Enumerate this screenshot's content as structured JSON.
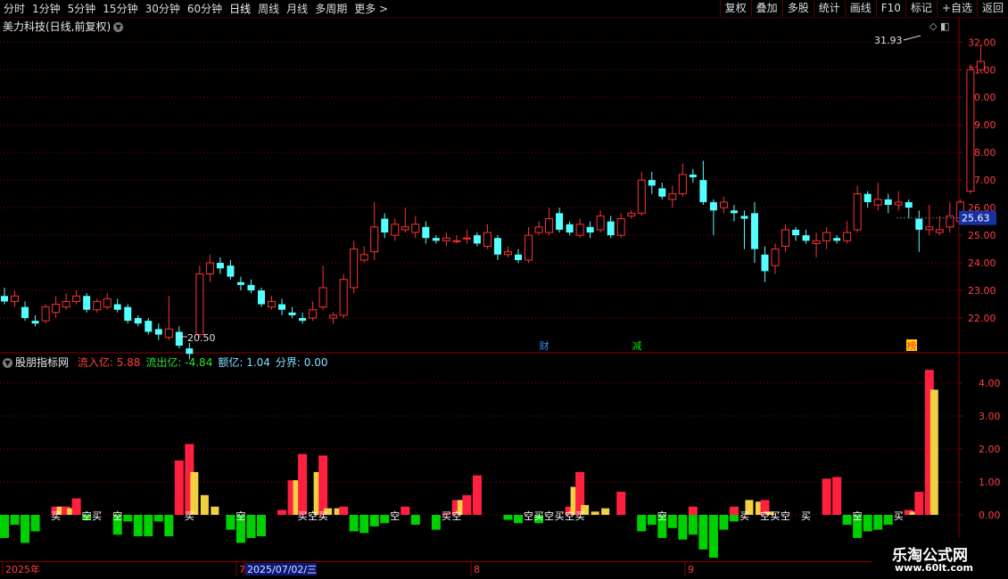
{
  "toolbar": {
    "periods": [
      "分时",
      "1分钟",
      "5分钟",
      "15分钟",
      "30分钟",
      "60分钟",
      "日线",
      "周线",
      "月线",
      "多周期",
      "更多 >"
    ],
    "active_period": "日线",
    "buttons": [
      "复权",
      "叠加",
      "多股",
      "统计",
      "画线",
      "F10",
      "标记",
      "+自选",
      "返回"
    ]
  },
  "main_chart": {
    "title": "美力科技(日线,前复权)",
    "price_ticks": [
      "32.00",
      "31.00",
      "30.00",
      "29.00",
      "28.00",
      "27.00",
      "26.00",
      "25.00",
      "24.00",
      "23.00",
      "22.00"
    ],
    "current_price": "25.63",
    "high_label": "31.93",
    "low_label": "20.50",
    "event_markers": [
      {
        "label": "财",
        "color": "#3a8cff"
      },
      {
        "label": "减",
        "color": "#00e000"
      },
      {
        "label": "榜",
        "color": "#ff3030",
        "bg": "#ffd000"
      }
    ]
  },
  "indicator": {
    "name": "股朋指标网",
    "fields": [
      {
        "label": "流入亿:",
        "value": "5.88",
        "color": "#ff4040"
      },
      {
        "label": "流出亿:",
        "value": "-4.84",
        "color": "#30e030"
      },
      {
        "label": "额亿:",
        "value": "1.04",
        "color": "#80e0ff"
      },
      {
        "label": "分界:",
        "value": "0.00",
        "color": "#80e0ff"
      }
    ],
    "ticks": [
      "4.00",
      "3.00",
      "2.00",
      "1.00",
      "0.00"
    ],
    "signals": {
      "buy": "买",
      "sell": "空"
    }
  },
  "date_axis": {
    "items": [
      {
        "label": "2025年",
        "highlight": false
      },
      {
        "label": "7",
        "highlight": false
      },
      {
        "label": "2025/07/02/三",
        "highlight": true
      },
      {
        "label": "8",
        "highlight": false
      },
      {
        "label": "9",
        "highlight": false
      }
    ]
  },
  "watermark": {
    "line1": "乐淘公式网",
    "line2": "www.60lt.com"
  },
  "colors": {
    "up": "#ff3232",
    "down": "#54ffff",
    "grid": "#8a0000",
    "inflow": "#ff2040",
    "outflow": "#00d000",
    "net": "#f0d040"
  },
  "chart_data": {
    "type": "candlestick",
    "y_range": [
      21.0,
      32.3
    ],
    "candles": [
      [
        22.8,
        22.6,
        23.1,
        22.5
      ],
      [
        22.6,
        22.8,
        23.0,
        22.4
      ],
      [
        22.4,
        22.0,
        22.6,
        21.9
      ],
      [
        21.9,
        21.8,
        22.1,
        21.7
      ],
      [
        21.9,
        22.4,
        22.5,
        21.8
      ],
      [
        22.2,
        22.5,
        22.8,
        22.0
      ],
      [
        22.4,
        22.6,
        22.9,
        22.3
      ],
      [
        22.6,
        22.8,
        23.0,
        22.5
      ],
      [
        22.8,
        22.3,
        22.9,
        22.2
      ],
      [
        22.3,
        22.6,
        22.7,
        22.2
      ],
      [
        22.4,
        22.7,
        22.9,
        22.3
      ],
      [
        22.5,
        22.3,
        22.7,
        22.2
      ],
      [
        22.4,
        21.9,
        22.5,
        21.8
      ],
      [
        22.0,
        21.8,
        22.1,
        21.7
      ],
      [
        21.9,
        21.5,
        22.0,
        21.4
      ],
      [
        21.6,
        21.4,
        21.8,
        21.2
      ],
      [
        21.3,
        21.6,
        22.8,
        21.2
      ],
      [
        21.5,
        21.0,
        21.7,
        20.9
      ],
      [
        20.9,
        20.7,
        21.1,
        20.5
      ],
      [
        21.4,
        23.6,
        23.9,
        21.3
      ],
      [
        23.6,
        24.0,
        24.3,
        23.3
      ],
      [
        24.0,
        23.8,
        24.2,
        23.6
      ],
      [
        23.9,
        23.5,
        24.1,
        23.4
      ],
      [
        23.3,
        23.2,
        23.5,
        23.0
      ],
      [
        23.2,
        23.0,
        23.4,
        22.9
      ],
      [
        23.0,
        22.5,
        23.1,
        22.4
      ],
      [
        22.4,
        22.6,
        22.8,
        22.3
      ],
      [
        22.5,
        22.3,
        22.7,
        22.1
      ],
      [
        22.2,
        22.1,
        22.4,
        22.0
      ],
      [
        22.0,
        21.9,
        22.2,
        21.8
      ],
      [
        22.0,
        22.3,
        22.6,
        21.9
      ],
      [
        22.4,
        23.1,
        23.9,
        22.3
      ],
      [
        22.0,
        22.1,
        22.2,
        21.8
      ],
      [
        22.1,
        23.4,
        23.6,
        22.0
      ],
      [
        23.1,
        24.5,
        24.8,
        22.9
      ],
      [
        24.1,
        24.3,
        24.6,
        24.0
      ],
      [
        24.4,
        25.3,
        26.2,
        24.1
      ],
      [
        25.6,
        25.1,
        25.8,
        24.9
      ],
      [
        25.0,
        25.4,
        25.6,
        24.8
      ],
      [
        25.2,
        25.3,
        26.0,
        25.1
      ],
      [
        25.1,
        25.4,
        25.7,
        24.9
      ],
      [
        25.3,
        24.9,
        25.5,
        24.7
      ],
      [
        24.9,
        24.8,
        25.0,
        24.7
      ],
      [
        24.8,
        24.9,
        25.1,
        24.6
      ],
      [
        24.8,
        24.8,
        25.0,
        24.7
      ],
      [
        24.9,
        24.9,
        25.2,
        24.7
      ],
      [
        25.0,
        24.7,
        25.1,
        24.6
      ],
      [
        24.6,
        25.1,
        25.4,
        24.5
      ],
      [
        24.9,
        24.3,
        25.0,
        24.1
      ],
      [
        24.3,
        24.4,
        24.6,
        24.2
      ],
      [
        24.3,
        24.1,
        24.5,
        24.0
      ],
      [
        24.1,
        25.0,
        25.3,
        24.0
      ],
      [
        25.1,
        25.3,
        25.5,
        25.0
      ],
      [
        25.1,
        25.6,
        26.0,
        25.0
      ],
      [
        25.8,
        25.2,
        26.0,
        25.1
      ],
      [
        25.4,
        25.1,
        25.5,
        25.0
      ],
      [
        25.0,
        25.4,
        25.6,
        24.9
      ],
      [
        25.3,
        25.1,
        25.5,
        24.9
      ],
      [
        25.2,
        25.7,
        25.9,
        25.1
      ],
      [
        25.5,
        25.0,
        25.7,
        24.9
      ],
      [
        25.0,
        25.6,
        25.8,
        24.9
      ],
      [
        25.7,
        25.8,
        25.9,
        25.6
      ],
      [
        25.8,
        27.0,
        27.3,
        25.7
      ],
      [
        27.0,
        26.8,
        27.3,
        26.5
      ],
      [
        26.7,
        26.4,
        26.9,
        26.3
      ],
      [
        26.3,
        26.5,
        26.8,
        26.0
      ],
      [
        26.5,
        27.2,
        27.6,
        26.4
      ],
      [
        27.2,
        27.1,
        27.4,
        26.9
      ],
      [
        27.0,
        26.2,
        27.7,
        26.1
      ],
      [
        26.2,
        25.9,
        26.3,
        25.0
      ],
      [
        26.0,
        26.2,
        26.4,
        25.8
      ],
      [
        25.9,
        25.8,
        26.1,
        25.5
      ],
      [
        25.7,
        25.6,
        25.9,
        24.5
      ],
      [
        25.8,
        24.5,
        26.2,
        24.0
      ],
      [
        24.3,
        23.7,
        24.6,
        23.3
      ],
      [
        23.9,
        24.5,
        24.7,
        23.6
      ],
      [
        24.6,
        25.2,
        25.4,
        24.4
      ],
      [
        25.2,
        25.0,
        25.3,
        24.8
      ],
      [
        25.0,
        24.8,
        25.2,
        24.7
      ],
      [
        24.7,
        24.8,
        25.1,
        24.2
      ],
      [
        24.8,
        25.1,
        25.3,
        24.5
      ],
      [
        24.9,
        24.8,
        25.0,
        24.7
      ],
      [
        24.8,
        25.1,
        25.5,
        24.7
      ],
      [
        25.2,
        26.5,
        26.8,
        25.1
      ],
      [
        26.5,
        26.2,
        26.6,
        26.0
      ],
      [
        26.1,
        26.3,
        26.9,
        25.9
      ],
      [
        26.3,
        26.1,
        26.5,
        25.8
      ],
      [
        26.1,
        26.2,
        26.6,
        25.9
      ],
      [
        26.2,
        26.0,
        26.3,
        25.6
      ],
      [
        25.6,
        25.2,
        25.9,
        24.4
      ],
      [
        25.2,
        25.3,
        26.1,
        25.0
      ],
      [
        25.1,
        25.2,
        25.7,
        25.0
      ],
      [
        25.3,
        25.7,
        26.2,
        25.1
      ],
      [
        25.5,
        26.2,
        26.3,
        25.4
      ],
      [
        26.6,
        31.0,
        31.2,
        26.5
      ],
      [
        31.0,
        31.3,
        31.9,
        30.9
      ]
    ],
    "inflow": [
      0.0,
      0.0,
      0.0,
      0.0,
      0.0,
      0.25,
      0.25,
      0.5,
      0.0,
      0.0,
      0.0,
      0.0,
      0.0,
      0.0,
      0.0,
      0.0,
      0.0,
      1.65,
      2.15,
      0.0,
      0.0,
      0.0,
      0.0,
      0.0,
      0.0,
      0.0,
      0.0,
      0.15,
      1.05,
      1.85,
      0.0,
      1.8,
      0.0,
      0.25,
      0.0,
      0.0,
      0.0,
      0.0,
      0.0,
      0.25,
      0.0,
      0.0,
      0.0,
      0.05,
      0.45,
      0.6,
      1.2,
      0.0,
      0.0,
      0.0,
      0.0,
      0.0,
      0.0,
      0.0,
      0.0,
      0.25,
      1.3,
      0.0,
      0.0,
      0.0,
      0.7,
      0.0,
      0.0,
      0.0,
      0.0,
      0.0,
      0.0,
      0.25,
      0.0,
      0.0,
      0.0,
      0.25,
      0.0,
      0.0,
      0.45,
      0.0,
      0.0,
      0.0,
      0.0,
      0.0,
      1.1,
      1.15,
      0.0,
      0.0,
      0.0,
      0.0,
      0.0,
      0.0,
      0.15,
      0.7,
      4.4
    ],
    "outflow": [
      -0.7,
      -0.3,
      -0.85,
      -0.5,
      0.0,
      0.0,
      0.0,
      0.0,
      -0.15,
      0.0,
      0.0,
      -0.6,
      -0.2,
      -0.65,
      -0.65,
      -0.2,
      -0.65,
      0.0,
      0.0,
      0.0,
      0.0,
      0.0,
      -0.45,
      -0.85,
      -0.7,
      -0.65,
      0.0,
      0.0,
      0.0,
      0.0,
      0.0,
      0.0,
      0.0,
      0.0,
      -0.5,
      -0.55,
      -0.35,
      -0.25,
      0.0,
      0.0,
      -0.3,
      0.0,
      -0.45,
      0.0,
      0.0,
      0.0,
      0.0,
      0.0,
      0.0,
      -0.15,
      -0.25,
      0.0,
      -0.25,
      0.0,
      0.0,
      0.0,
      0.0,
      0.0,
      0.0,
      0.0,
      0.0,
      0.0,
      -0.5,
      -0.3,
      -0.7,
      -0.4,
      -0.75,
      -0.6,
      -1.05,
      -1.3,
      -0.45,
      -0.2,
      0.0,
      0.0,
      0.0,
      0.0,
      0.0,
      0.0,
      0.0,
      0.0,
      0.0,
      0.0,
      -0.3,
      -0.7,
      -0.5,
      -0.45,
      -0.3,
      0.0,
      0.0,
      0.0,
      0.0
    ],
    "net": [
      0.0,
      0.0,
      0.0,
      0.0,
      0.0,
      0.25,
      0.2,
      0.0,
      0.0,
      0.0,
      0.0,
      0.0,
      0.0,
      0.0,
      0.0,
      0.0,
      0.0,
      0.0,
      1.3,
      0.6,
      0.25,
      0.0,
      0.0,
      0.0,
      0.0,
      0.0,
      0.0,
      0.0,
      1.05,
      0.0,
      1.3,
      0.2,
      0.2,
      0.0,
      0.0,
      0.0,
      0.0,
      0.0,
      0.0,
      0.0,
      0.0,
      0.0,
      0.0,
      0.0,
      0.45,
      0.0,
      0.0,
      0.0,
      0.0,
      0.0,
      0.0,
      0.0,
      0.0,
      0.0,
      0.0,
      0.85,
      0.3,
      0.1,
      0.2,
      0.0,
      0.0,
      0.0,
      0.0,
      0.0,
      0.0,
      0.0,
      0.0,
      0.0,
      0.0,
      0.0,
      0.0,
      0.0,
      0.45,
      0.4,
      0.1,
      0.0,
      0.0,
      0.0,
      0.0,
      0.0,
      0.0,
      0.0,
      0.0,
      0.0,
      0.0,
      0.0,
      0.0,
      0.0,
      0.1,
      0.0,
      3.8
    ],
    "signal_positions": [
      {
        "index": 5,
        "type": "buy"
      },
      {
        "index": 8,
        "type": "sell"
      },
      {
        "index": 9,
        "type": "buy"
      },
      {
        "index": 11,
        "type": "sell"
      },
      {
        "index": 18,
        "type": "buy"
      },
      {
        "index": 23,
        "type": "sell"
      },
      {
        "index": 29,
        "type": "buy"
      },
      {
        "index": 30,
        "type": "sell"
      },
      {
        "index": 31,
        "type": "buy"
      },
      {
        "index": 38,
        "type": "sell"
      },
      {
        "index": 43,
        "type": "buy"
      },
      {
        "index": 44,
        "type": "sell"
      },
      {
        "index": 51,
        "type": "sell"
      },
      {
        "index": 52,
        "type": "buy"
      },
      {
        "index": 53,
        "type": "sell"
      },
      {
        "index": 54,
        "type": "buy"
      },
      {
        "index": 55,
        "type": "sell"
      },
      {
        "index": 56,
        "type": "buy"
      },
      {
        "index": 64,
        "type": "sell"
      },
      {
        "index": 72,
        "type": "buy"
      },
      {
        "index": 74,
        "type": "sell"
      },
      {
        "index": 75,
        "type": "buy"
      },
      {
        "index": 76,
        "type": "sell"
      },
      {
        "index": 78,
        "type": "buy"
      },
      {
        "index": 83,
        "type": "sell"
      },
      {
        "index": 87,
        "type": "buy"
      }
    ]
  }
}
